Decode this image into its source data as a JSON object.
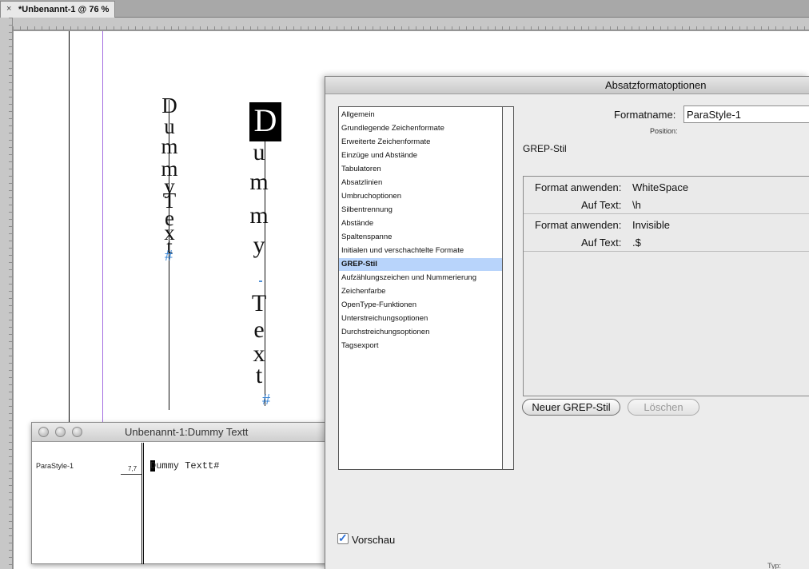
{
  "tab": {
    "title": "*Unbenannt-1 @ 76 %",
    "close": "×"
  },
  "canvas": {
    "frame1": {
      "chars": [
        "D",
        "u",
        "m",
        "m",
        "y",
        "T",
        "e",
        "x",
        "t",
        "#"
      ]
    },
    "frame2": {
      "chars": [
        "D",
        "u",
        "m",
        "m",
        "y",
        "T",
        "e",
        "x",
        "t",
        "#"
      ]
    }
  },
  "story_editor": {
    "title": "Unbenannt-1:Dummy Textt",
    "style": "ParaStyle-1",
    "depth": "7,7",
    "text": "Dummy Textt#"
  },
  "dialog": {
    "title": "Absatzformatoptionen",
    "categories": [
      "Allgemein",
      "Grundlegende Zeichenformate",
      "Erweiterte Zeichenformate",
      "Einzüge und Abstände",
      "Tabulatoren",
      "Absatzlinien",
      "Umbruchoptionen",
      "Silbentrennung",
      "Abstände",
      "Spaltenspanne",
      "Initialen und verschachtelte Formate",
      "GREP-Stil",
      "Aufzählungszeichen und Nummerierung",
      "Zeichenfarbe",
      "OpenType-Funktionen",
      "Unterstreichungsoptionen",
      "Durchstreichungsoptionen",
      "Tagsexport"
    ],
    "selected_category": "GREP-Stil",
    "formatname_label": "Formatname:",
    "formatname_value": "ParaStyle-1",
    "position_label": "Position:",
    "section_title": "GREP-Stil",
    "rules": [
      {
        "label_format": "Format anwenden:",
        "format": "WhiteSpace",
        "label_text": "Auf Text:",
        "text": "\\h"
      },
      {
        "label_format": "Format anwenden:",
        "format": "Invisible",
        "label_text": "Auf Text:",
        "text": ".$"
      }
    ],
    "btn_new": "Neuer GREP-Stil",
    "btn_delete": "Löschen",
    "preview_label": "Vorschau",
    "preview_checked": true
  },
  "status": {
    "typ": "Typ:"
  }
}
